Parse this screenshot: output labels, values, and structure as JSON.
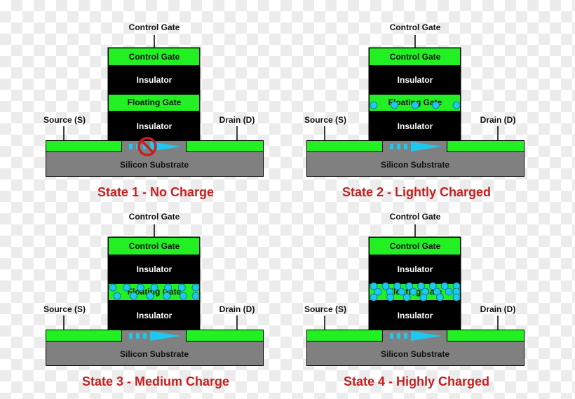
{
  "labels": {
    "control_gate_terminal": "Control Gate",
    "control_gate": "Control Gate",
    "insulator": "Insulator",
    "floating_gate": "Floating Gate",
    "source": "Source (S)",
    "drain": "Drain (D)",
    "substrate": "Silicon Substrate"
  },
  "colors": {
    "gate_green": "#22f022",
    "insulator_black": "#000000",
    "substrate_gray": "#808080",
    "electron_cyan": "#1ec8f0",
    "title_red": "#c81e1e"
  },
  "states": [
    {
      "title": "State 1 - No Charge",
      "electrons": 0,
      "current_blocked": true
    },
    {
      "title": "State 2 - Lightly Charged",
      "electrons": 5,
      "current_blocked": false
    },
    {
      "title": "State 3 - Medium Charge",
      "electrons": 13,
      "current_blocked": false
    },
    {
      "title": "State 4 - Highly Charged",
      "electrons": 22,
      "current_blocked": false
    }
  ]
}
